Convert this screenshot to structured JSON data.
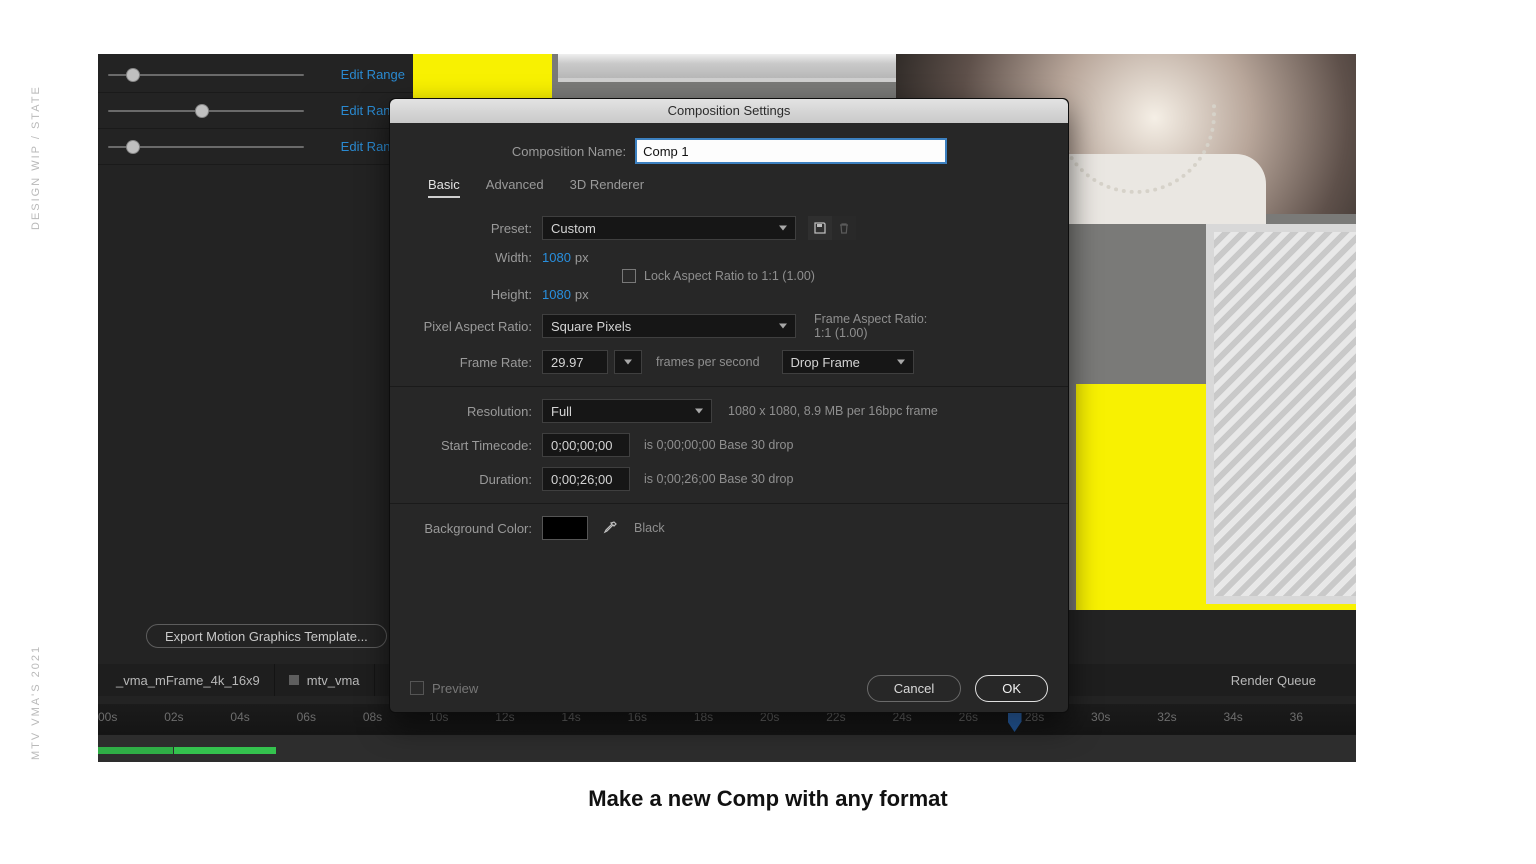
{
  "slide": {
    "side_top": "DESIGN WIP / STATE",
    "side_bottom": "MTV VMA's 2021",
    "caption": "Make a new Comp with any format"
  },
  "left_panel": {
    "rows": [
      {
        "thumb_pct": 13,
        "link": "Edit Range"
      },
      {
        "thumb_pct": 48,
        "link": "Edit Range"
      },
      {
        "thumb_pct": 13,
        "link": "Edit Range"
      }
    ],
    "export_button": "Export Motion Graphics Template..."
  },
  "comp_tabs": {
    "tab1": "_vma_mFrame_4k_16x9",
    "tab2": "mtv_vma",
    "render_queue": "Render Queue"
  },
  "time_ruler": {
    "marks": [
      "00s",
      "02s",
      "04s",
      "06s",
      "08s",
      "10s",
      "12s",
      "14s",
      "16s",
      "18s",
      "20s",
      "22s",
      "24s",
      "26s",
      "28s",
      "30s",
      "32s",
      "34s",
      "36"
    ],
    "cti_pct": 72.3
  },
  "dialog": {
    "title": "Composition Settings",
    "comp_name_label": "Composition Name:",
    "comp_name_value": "Comp 1",
    "tabs": {
      "basic": "Basic",
      "advanced": "Advanced",
      "renderer": "3D Renderer"
    },
    "preset_label": "Preset:",
    "preset_value": "Custom",
    "width_label": "Width:",
    "width_value": "1080",
    "height_label": "Height:",
    "height_value": "1080",
    "px": "px",
    "lock_ar_label": "Lock Aspect Ratio to 1:1 (1.00)",
    "par_label": "Pixel Aspect Ratio:",
    "par_value": "Square Pixels",
    "frame_ar_label": "Frame Aspect Ratio:",
    "frame_ar_value": "1:1 (1.00)",
    "fr_label": "Frame Rate:",
    "fr_value": "29.97",
    "fr_unit": "frames per second",
    "drop_value": "Drop Frame",
    "res_label": "Resolution:",
    "res_value": "Full",
    "res_hint": "1080 x 1080, 8.9 MB per 16bpc frame",
    "start_tc_label": "Start Timecode:",
    "start_tc_value": "0;00;00;00",
    "start_tc_hint": "is 0;00;00;00  Base 30  drop",
    "dur_label": "Duration:",
    "dur_value": "0;00;26;00",
    "dur_hint": "is 0;00;26;00  Base 30  drop",
    "bg_label": "Background Color:",
    "bg_name": "Black",
    "preview_label": "Preview",
    "cancel": "Cancel",
    "ok": "OK"
  }
}
